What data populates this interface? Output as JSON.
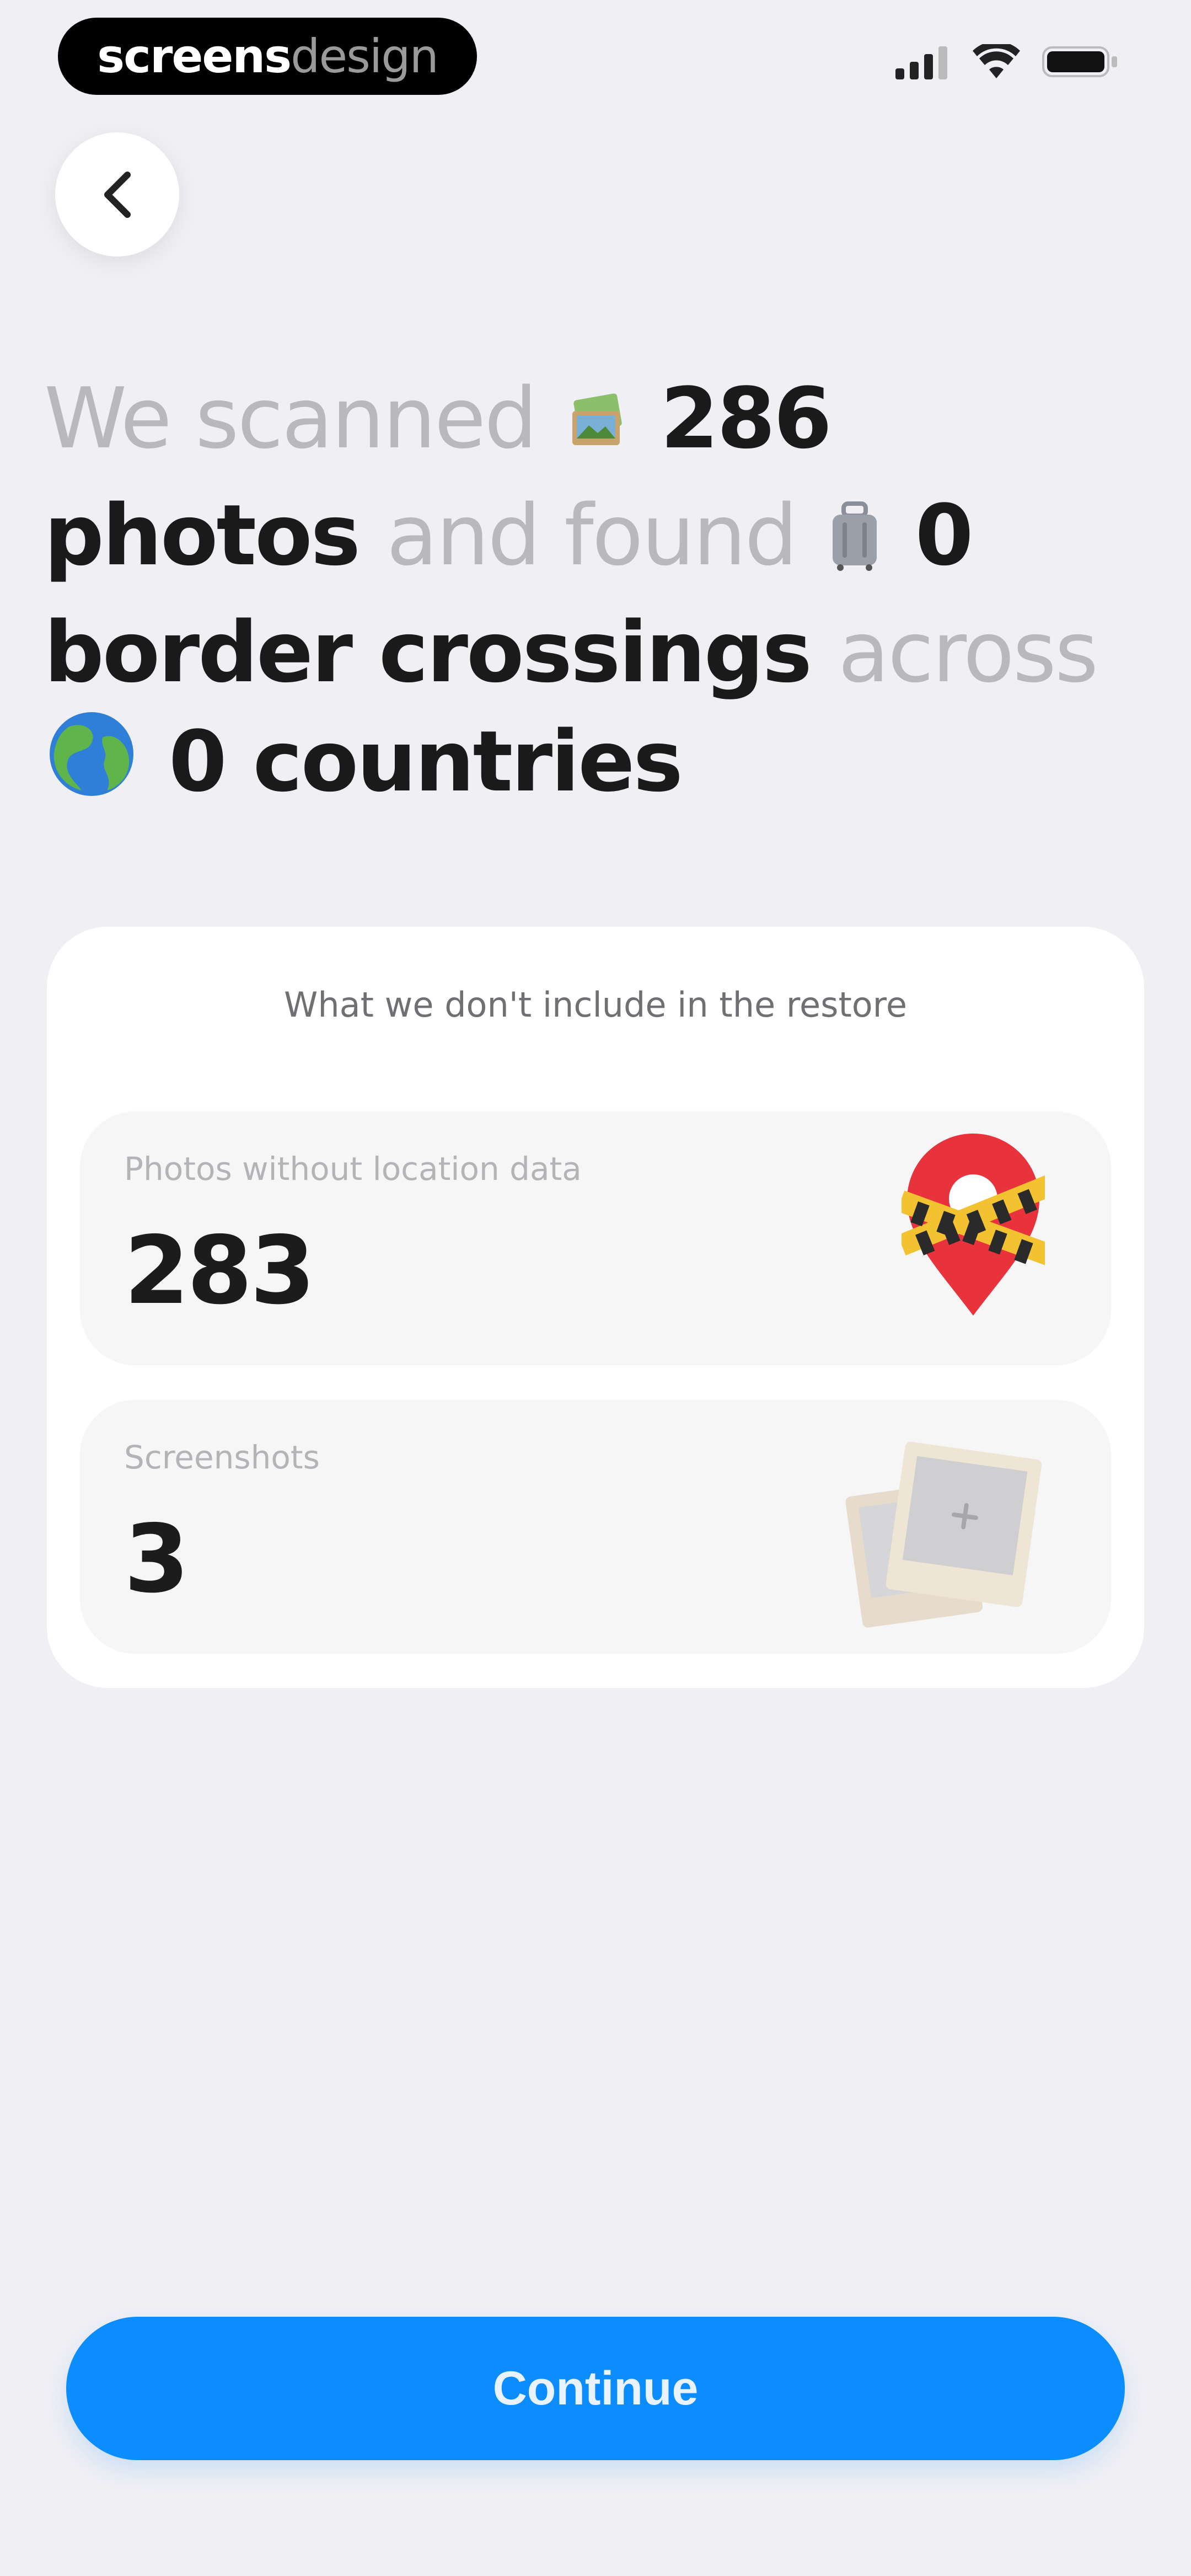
{
  "status_bar": {
    "brand_a": "screens",
    "brand_b": "design",
    "icons": [
      "signal-icon",
      "wifi-icon",
      "battery-icon"
    ]
  },
  "nav": {
    "back_icon": "chevron-left-icon"
  },
  "headline": {
    "t1": "We scanned",
    "photos_count": "286",
    "photos_word": "photos",
    "t2": "and found",
    "crossings_count": "0",
    "crossings_word": "border crossings",
    "t3": "across",
    "countries_count": "0",
    "countries_word": "countries",
    "icons": [
      "photos-emoji",
      "luggage-emoji",
      "globe-emoji"
    ]
  },
  "card": {
    "title": "What we don't include in the restore",
    "rows": [
      {
        "label": "Photos without location data",
        "value": "283",
        "icon": "location-pin-taped-icon"
      },
      {
        "label": "Screenshots",
        "value": "3",
        "icon": "screenshot-photos-icon"
      }
    ]
  },
  "continue_label": "Continue",
  "colors": {
    "background": "#efeff4",
    "accent": "#0b8cff",
    "pin_red": "#e8323c"
  }
}
